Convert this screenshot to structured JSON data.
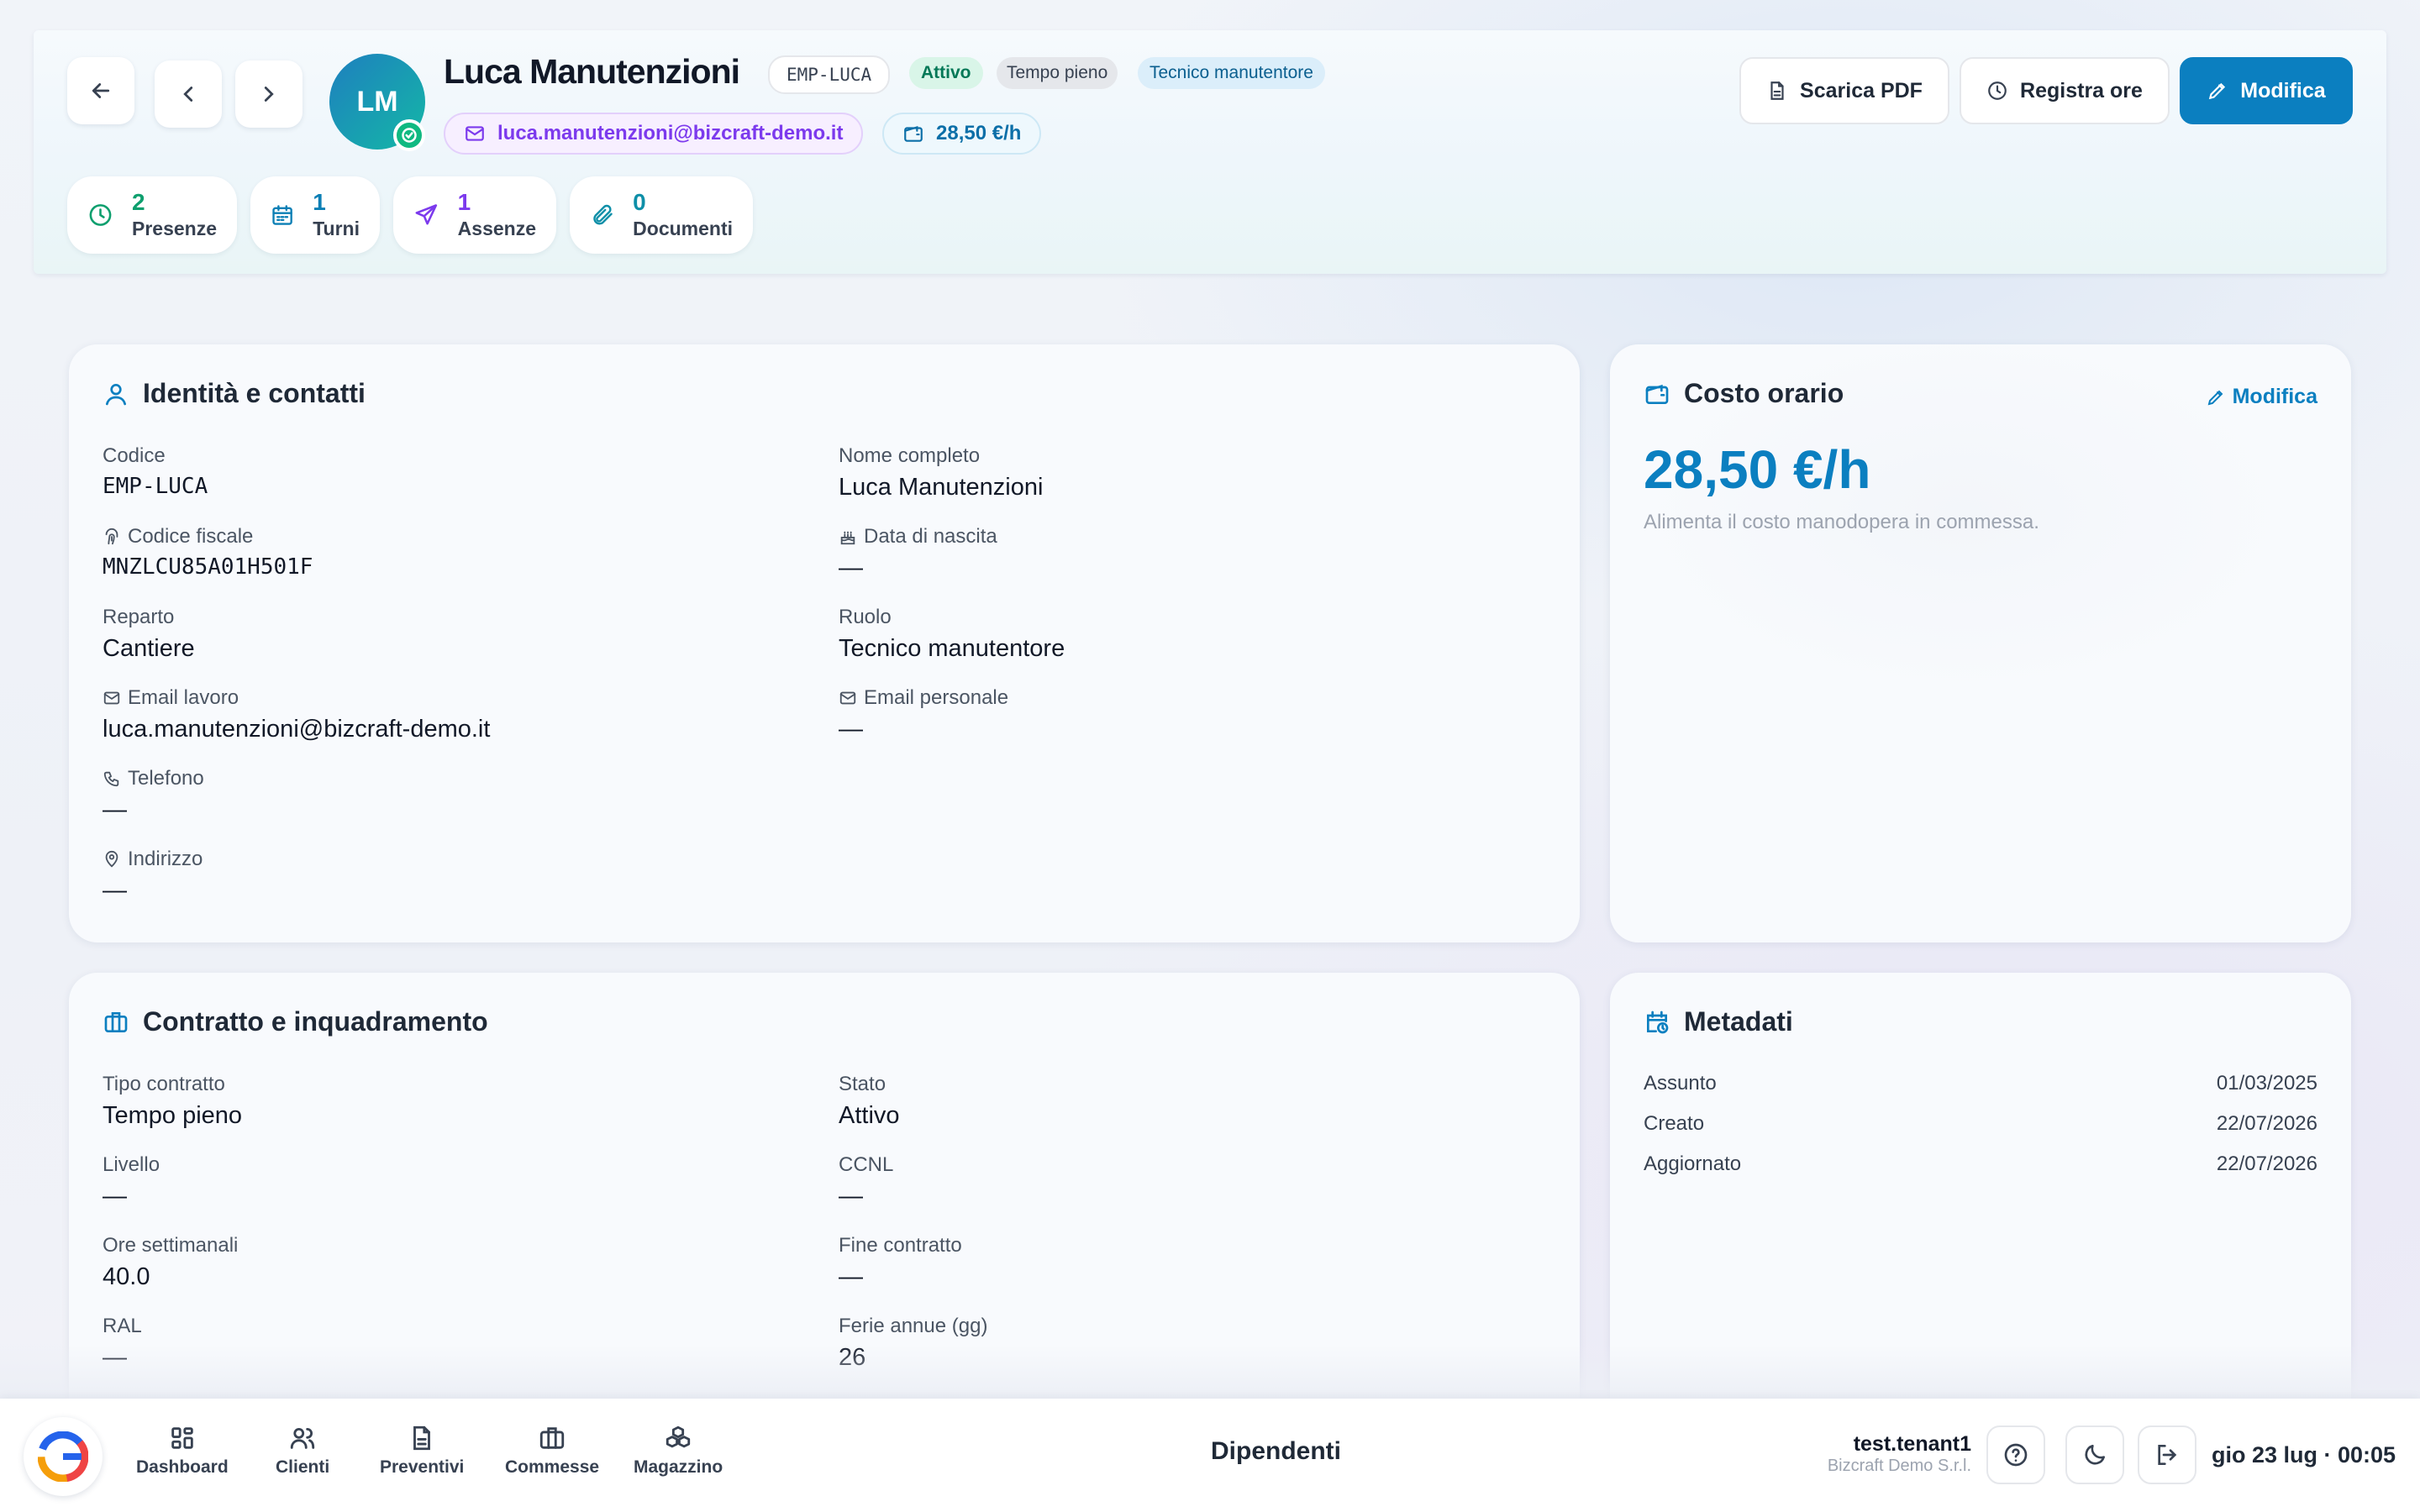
{
  "header": {
    "name": "Luca Manutenzioni",
    "initials": "LM",
    "code": "EMP-LUCA",
    "badges": [
      "Attivo",
      "Tempo pieno",
      "Tecnico manutentore"
    ],
    "email": "luca.manutenzioni@bizcraft-demo.it",
    "rate": "28,50 €/h",
    "actions": {
      "pdf": "Scarica PDF",
      "hours": "Registra ore",
      "edit": "Modifica"
    },
    "stats": [
      {
        "num": "2",
        "label": "Presenze",
        "color": "#0e9f6e"
      },
      {
        "num": "1",
        "label": "Turni",
        "color": "#0b7fb5"
      },
      {
        "num": "1",
        "label": "Assenze",
        "color": "#7c3aed"
      },
      {
        "num": "0",
        "label": "Documenti",
        "color": "#0e8fa8"
      }
    ]
  },
  "identity": {
    "title": "Identità e contatti",
    "fields": [
      {
        "label": "Codice",
        "value": "EMP-LUCA"
      },
      {
        "label": "Nome completo",
        "value": "Luca Manutenzioni"
      },
      {
        "label": "Codice fiscale",
        "value": "MNZLCU85A01H501F"
      },
      {
        "label": "Data di nascita",
        "value": "—"
      },
      {
        "label": "Reparto",
        "value": "Cantiere"
      },
      {
        "label": "Ruolo",
        "value": "Tecnico manutentore"
      },
      {
        "label": "Email lavoro",
        "value": "luca.manutenzioni@bizcraft-demo.it"
      },
      {
        "label": "Email personale",
        "value": "—"
      },
      {
        "label": "Telefono",
        "value": "—"
      },
      {
        "label": "Indirizzo",
        "value": "—"
      }
    ]
  },
  "cost": {
    "title": "Costo orario",
    "edit": "Modifica",
    "value": "28,50 €/h",
    "note": "Alimenta il costo manodopera in commessa."
  },
  "contract": {
    "title": "Contratto e inquadramento",
    "fields": [
      {
        "label": "Tipo contratto",
        "value": "Tempo pieno"
      },
      {
        "label": "Stato",
        "value": "Attivo"
      },
      {
        "label": "Livello",
        "value": "—"
      },
      {
        "label": "CCNL",
        "value": "—"
      },
      {
        "label": "Ore settimanali",
        "value": "40.0"
      },
      {
        "label": "Fine contratto",
        "value": "—"
      },
      {
        "label": "RAL",
        "value": "—"
      },
      {
        "label": "Ferie annue (gg)",
        "value": "26"
      }
    ]
  },
  "metadata": {
    "title": "Metadati",
    "rows": [
      {
        "label": "Assunto",
        "value": "01/03/2025"
      },
      {
        "label": "Creato",
        "value": "22/07/2026"
      },
      {
        "label": "Aggiornato",
        "value": "22/07/2026"
      }
    ]
  },
  "bottombar": {
    "nav": [
      "Dashboard",
      "Clienti",
      "Preventivi",
      "Commesse",
      "Magazzino"
    ],
    "section": "Dipendenti",
    "user": "test.tenant1",
    "company": "Bizcraft Demo S.r.l.",
    "datetime": "gio 23 lug · 00:05"
  },
  "colors": {
    "accent": "#0b7fc0",
    "success": "#10b981",
    "purple": "#7c3aed"
  }
}
